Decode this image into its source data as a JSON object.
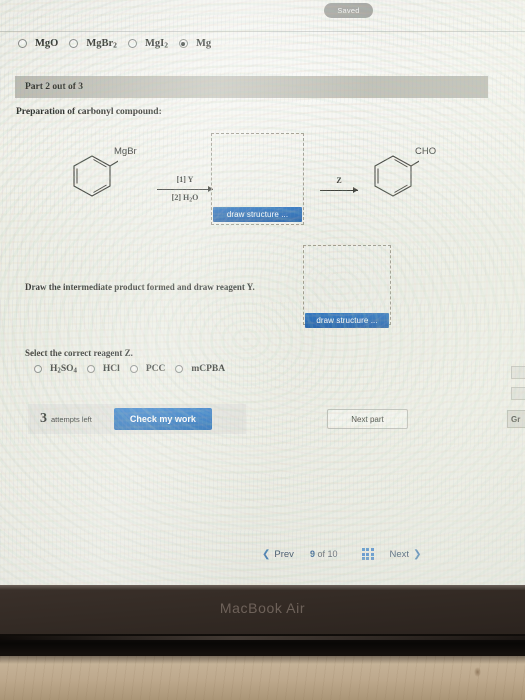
{
  "status": {
    "saved_label": "Saved"
  },
  "answer_options": {
    "prompt_options": [
      {
        "label": "MgO",
        "selected": false
      },
      {
        "label": "MgBr2",
        "selected": false
      },
      {
        "label": "MgI2",
        "selected": false
      },
      {
        "label": "Mg",
        "selected": true
      }
    ]
  },
  "part_banner": {
    "label": "Part 2 out of 3"
  },
  "question": {
    "heading": "Preparation of carbonyl compound:",
    "intermediate_prompt": "Draw the intermediate product formed and draw reagent Y.",
    "select_reagent_prompt": "Select the correct reagent Z."
  },
  "scheme": {
    "reactant_label": "MgBr",
    "product_label": "CHO",
    "arrow1_top": "[1] Y",
    "arrow1_bottom": "[2] H2O",
    "arrow2_top": "Z",
    "draw_button_1": "draw structure ...",
    "draw_button_2": "draw structure ..."
  },
  "reagent_z_options": [
    {
      "label": "H2SO4",
      "selected": false
    },
    {
      "label": "HCl",
      "selected": false
    },
    {
      "label": "PCC",
      "selected": false
    },
    {
      "label": "mCPBA",
      "selected": false
    }
  ],
  "actions": {
    "attempts_count": "3",
    "attempts_label": "attempts left",
    "check_label": "Check my work",
    "next_part_label": "Next part",
    "edge_button_label": "Gr"
  },
  "pager": {
    "prev_label": "Prev",
    "current_page": "9",
    "of_label": "of",
    "total_pages": "10",
    "next_label": "Next",
    "grid_icon": "grid-icon"
  },
  "device": {
    "brand": "MacBook Air"
  },
  "colors": {
    "accent_blue": "#1565b8",
    "link_blue": "#1c4f86",
    "banner_gray": "#b7b7ae"
  }
}
